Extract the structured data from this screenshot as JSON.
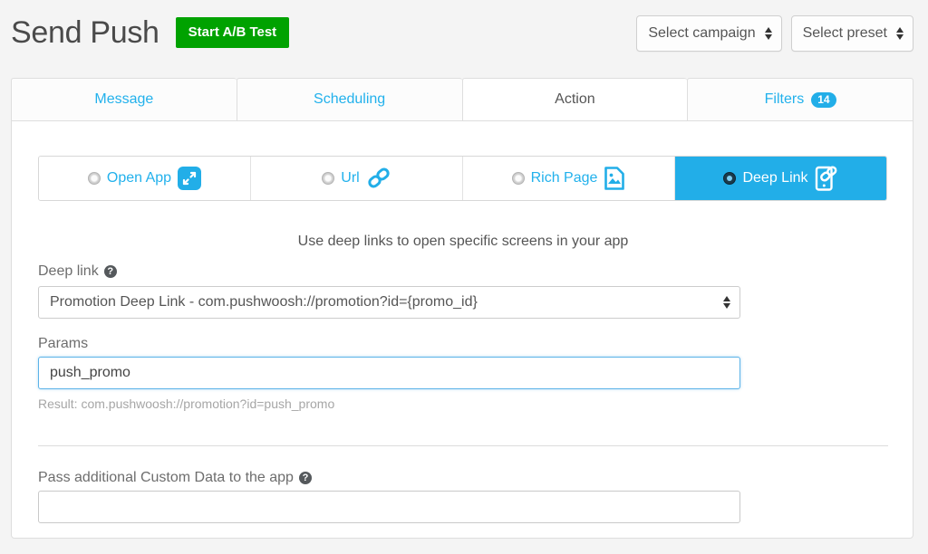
{
  "header": {
    "title": "Send Push",
    "ab_test_button": "Start A/B Test",
    "campaign_select": "Select campaign",
    "preset_select": "Select preset"
  },
  "tabs": [
    {
      "label": "Message",
      "active": false
    },
    {
      "label": "Scheduling",
      "active": false
    },
    {
      "label": "Action",
      "active": true
    },
    {
      "label": "Filters",
      "active": false,
      "badge": "14"
    }
  ],
  "action_types": [
    {
      "label": "Open App",
      "icon": "expand-arrows-icon",
      "selected": false
    },
    {
      "label": "Url",
      "icon": "chain-link-icon",
      "selected": false
    },
    {
      "label": "Rich Page",
      "icon": "image-document-icon",
      "selected": false
    },
    {
      "label": "Deep Link",
      "icon": "phone-link-icon",
      "selected": true
    }
  ],
  "form": {
    "hint": "Use deep links to open specific screens in your app",
    "deeplink_label": "Deep link",
    "deeplink_value": "Promotion Deep Link - com.pushwoosh://promotion?id={promo_id}",
    "params_label": "Params",
    "params_value": "push_promo",
    "result_text": "Result: com.pushwoosh://promotion?id=push_promo",
    "custom_data_label": "Pass additional Custom Data to the app",
    "custom_data_value": ""
  },
  "colors": {
    "accent_blue": "#22aee8",
    "link_blue": "#22b1ec",
    "green": "#00a200",
    "page_bg": "#f4f4f4"
  }
}
